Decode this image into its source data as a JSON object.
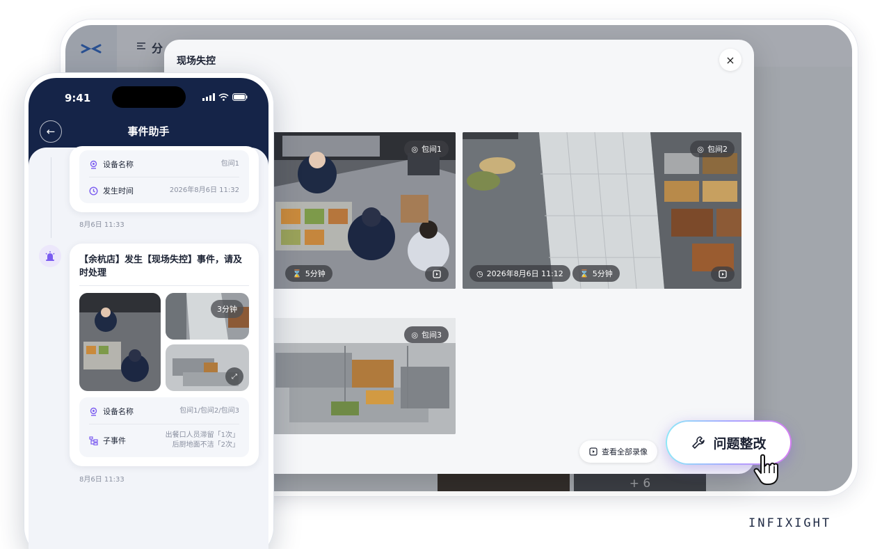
{
  "tablet": {
    "topbar_text": "分",
    "modal": {
      "title": "现场失控",
      "close": "×",
      "cameras": [
        {
          "room": "包间1",
          "time": "",
          "duration": "5分钟"
        },
        {
          "room": "包间2",
          "time": "2026年8月6日 11:12",
          "duration": "5分钟"
        },
        {
          "room": "包间3"
        }
      ],
      "view_all_label": "查看全部录像"
    },
    "more_count": "+ 6"
  },
  "rectify_button": {
    "label": "问题整改"
  },
  "brand": "INFIXIGHT",
  "phone": {
    "time": "9:41",
    "title": "事件助手",
    "back_icon": "←",
    "first_card": {
      "rows": [
        {
          "label": "设备名称",
          "value": "包间1"
        },
        {
          "label": "发生时间",
          "value": "2026年8月6日 11:32"
        }
      ],
      "stamp": "8月6日 11:33"
    },
    "alert_card": {
      "title": "【余杭店】发生【现场失控】事件，请及时处理",
      "thumb_duration": "3分钟",
      "rows": [
        {
          "label": "设备名称",
          "value": "包间1/包间2/包间3"
        },
        {
          "label": "子事件",
          "value_line1": "出餐口人员滞留「1次」",
          "value_line2": "后厨地面不洁「2次」"
        }
      ],
      "stamp": "8月6日 11:33"
    }
  },
  "colors": {
    "phone_header": "#152448",
    "accent_purple": "#7b5cf0",
    "gradient_start": "#8fe8f7",
    "gradient_end": "#d47cf2"
  }
}
